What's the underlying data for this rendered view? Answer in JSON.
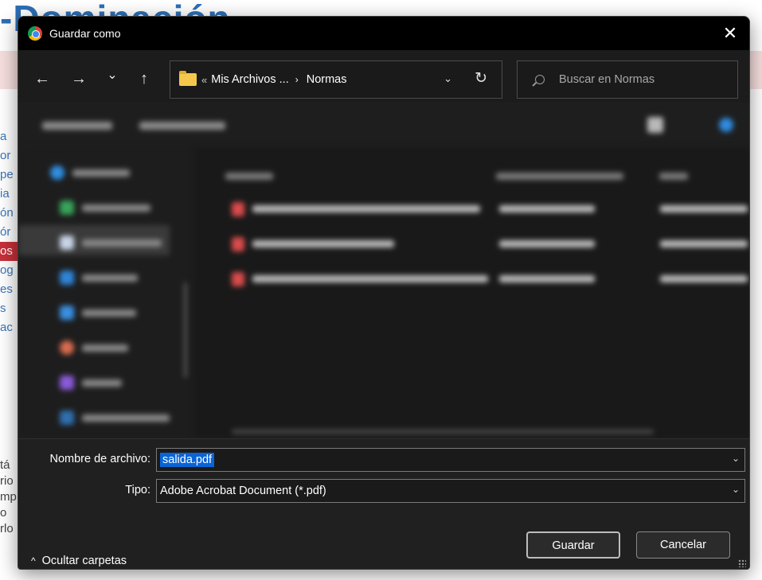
{
  "background_page": {
    "heading": "-Dominación",
    "nav_fragments": [
      "a",
      "or",
      "pe",
      "ia",
      "ón",
      "ór",
      "os",
      "og",
      "es",
      "s",
      "ac"
    ],
    "active_index": 6,
    "lower_fragments": [
      "tá",
      "rio",
      "mp",
      "o",
      "rlo"
    ]
  },
  "dialog": {
    "title": "Guardar como",
    "close_glyph": "✕",
    "nav": {
      "back_glyph": "←",
      "forward_glyph": "→",
      "recent_glyph": "⌄",
      "up_glyph": "↑"
    },
    "address": {
      "overflow_glyph": "«",
      "crumb_parent": "Mis Archivos ...",
      "crumb_sep": "›",
      "crumb_current": "Normas",
      "dropdown_glyph": "⌄",
      "refresh_glyph": "↻"
    },
    "search": {
      "placeholder": "Buscar en Normas"
    },
    "form": {
      "filename_label": "Nombre de archivo:",
      "filename_value": "salida.pdf",
      "type_label": "Tipo:",
      "type_value": "Adobe Acrobat Document (*.pdf)",
      "chevron_glyph": "⌄"
    },
    "footer": {
      "toggle_glyph": "^",
      "toggle_label": "Ocultar carpetas",
      "save_label": "Guardar",
      "cancel_label": "Cancelar"
    }
  },
  "colors": {
    "accent": "#0a64d6",
    "dialog_bg": "#202020",
    "titlebar_bg": "#000000"
  }
}
